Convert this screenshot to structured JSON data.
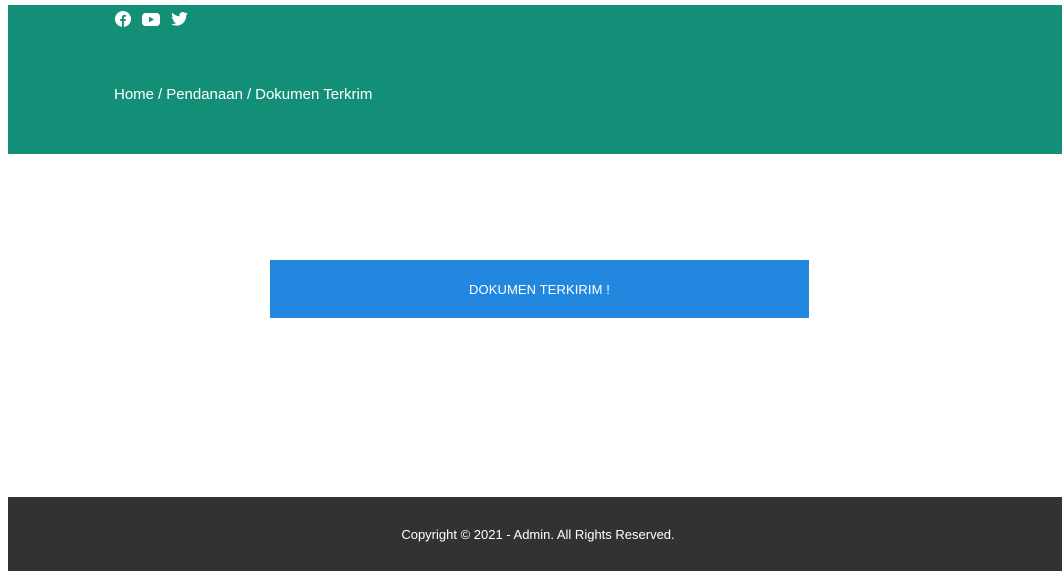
{
  "header": {
    "background": "#148f77",
    "social": [
      {
        "name": "facebook",
        "icon": "facebook-icon"
      },
      {
        "name": "youtube",
        "icon": "youtube-icon"
      },
      {
        "name": "twitter",
        "icon": "twitter-icon"
      }
    ],
    "breadcrumb": {
      "home": "Home",
      "separator": "/",
      "section": "Pendanaan",
      "current": "Dokumen Terkrim"
    }
  },
  "main": {
    "banner_text": "DOKUMEN TERKIRIM !",
    "banner_color": "#2287de"
  },
  "footer": {
    "background": "#323232",
    "copyright": "Copyright © 2021 - Admin. All Rights Reserved."
  }
}
